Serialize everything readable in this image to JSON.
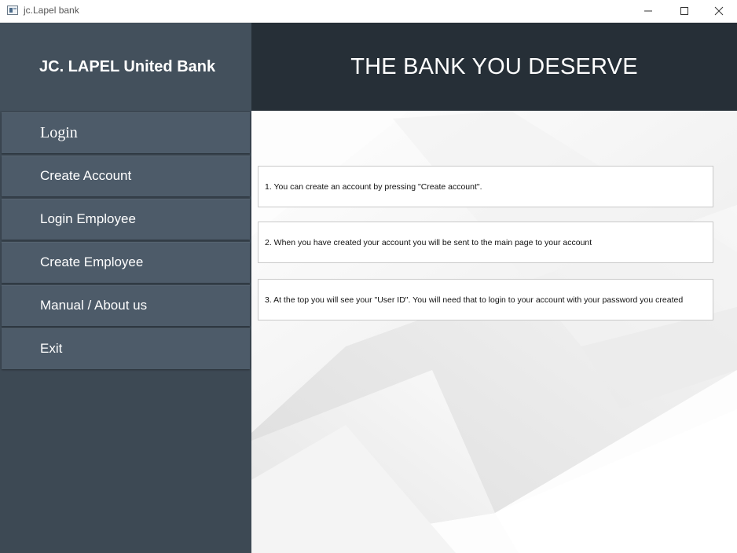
{
  "window": {
    "title": "jc.Lapel bank",
    "icon": "app-window-icon",
    "controls": [
      "minimize-icon",
      "maximize-icon",
      "close-icon"
    ]
  },
  "sidebar": {
    "brand": "JC. LAPEL United Bank",
    "items": [
      {
        "label": "Login"
      },
      {
        "label": "Create Account"
      },
      {
        "label": "Login Employee"
      },
      {
        "label": "Create Employee"
      },
      {
        "label": "Manual / About us"
      },
      {
        "label": "Exit"
      }
    ]
  },
  "header": {
    "title": "THE BANK YOU DESERVE"
  },
  "main": {
    "instructions": [
      "1. You can create an account by pressing \"Create account\".",
      "2. When you have created your account you will be sent to the main page to your account",
      "3. At the top you will see your \"User ID\". You will need that to login to your account with your password you created"
    ]
  },
  "colors": {
    "sidebar": "#3d4954",
    "brand_panel": "#43505c",
    "nav_item": "#4d5b69",
    "header": "#262f37",
    "content_bg": "#ffffff"
  }
}
